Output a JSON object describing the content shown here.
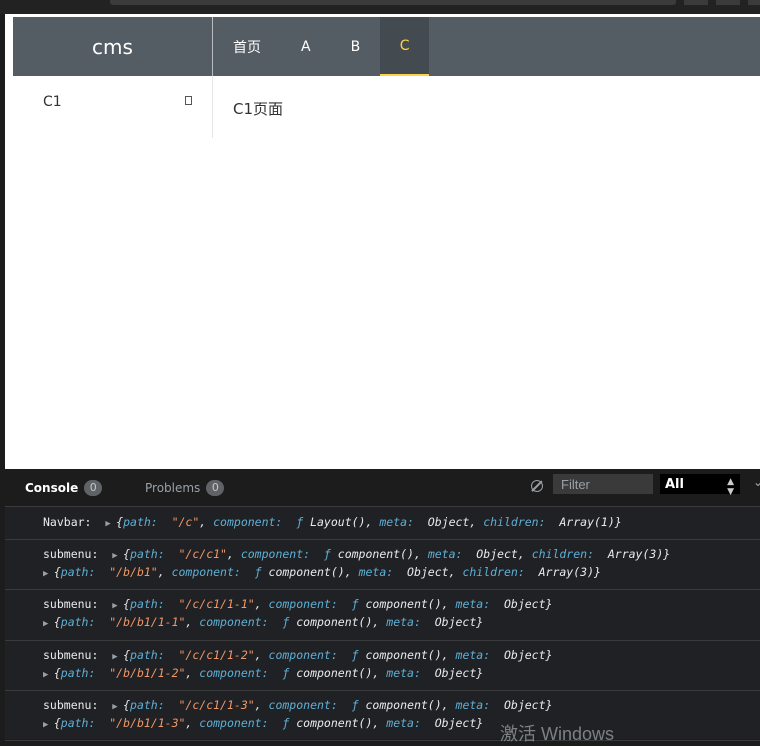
{
  "app": {
    "logo": "cms",
    "nav": [
      "首页",
      "A",
      "B",
      "C"
    ],
    "active_nav": "C",
    "sidebar_item": "C1",
    "main_text": "C1页面"
  },
  "devtools": {
    "tabs": [
      {
        "label": "Console",
        "count": "0"
      },
      {
        "label": "Problems",
        "count": "0"
      }
    ],
    "filter_placeholder": "Filter",
    "level": "All",
    "messages": [
      {
        "label": "Navbar:",
        "objects": [
          [
            [
              "k",
              "path"
            ],
            [
              "s",
              "\"/c\""
            ],
            [
              "k",
              "component"
            ],
            [
              "f",
              "ƒ"
            ],
            [
              "p",
              "Layout()"
            ],
            [
              "k",
              "meta"
            ],
            [
              "p",
              "Object"
            ],
            [
              "k",
              "children"
            ],
            [
              "p",
              "Array(1)"
            ]
          ]
        ]
      },
      {
        "label": "submenu:",
        "objects": [
          [
            [
              "k",
              "path"
            ],
            [
              "s",
              "\"/c/c1\""
            ],
            [
              "k",
              "component"
            ],
            [
              "f",
              "ƒ"
            ],
            [
              "p",
              "component()"
            ],
            [
              "k",
              "meta"
            ],
            [
              "p",
              "Object"
            ],
            [
              "k",
              "children"
            ],
            [
              "p",
              "Array(3)"
            ]
          ],
          [
            [
              "k",
              "path"
            ],
            [
              "s",
              "\"/b/b1\""
            ],
            [
              "k",
              "component"
            ],
            [
              "f",
              "ƒ"
            ],
            [
              "p",
              "component()"
            ],
            [
              "k",
              "meta"
            ],
            [
              "p",
              "Object"
            ],
            [
              "k",
              "children"
            ],
            [
              "p",
              "Array(3)"
            ]
          ]
        ]
      },
      {
        "label": "submenu:",
        "objects": [
          [
            [
              "k",
              "path"
            ],
            [
              "s",
              "\"/c/c1/1-1\""
            ],
            [
              "k",
              "component"
            ],
            [
              "f",
              "ƒ"
            ],
            [
              "p",
              "component()"
            ],
            [
              "k",
              "meta"
            ],
            [
              "p",
              "Object"
            ]
          ],
          [
            [
              "k",
              "path"
            ],
            [
              "s",
              "\"/b/b1/1-1\""
            ],
            [
              "k",
              "component"
            ],
            [
              "f",
              "ƒ"
            ],
            [
              "p",
              "component()"
            ],
            [
              "k",
              "meta"
            ],
            [
              "p",
              "Object"
            ]
          ]
        ]
      },
      {
        "label": "submenu:",
        "objects": [
          [
            [
              "k",
              "path"
            ],
            [
              "s",
              "\"/c/c1/1-2\""
            ],
            [
              "k",
              "component"
            ],
            [
              "f",
              "ƒ"
            ],
            [
              "p",
              "component()"
            ],
            [
              "k",
              "meta"
            ],
            [
              "p",
              "Object"
            ]
          ],
          [
            [
              "k",
              "path"
            ],
            [
              "s",
              "\"/b/b1/1-2\""
            ],
            [
              "k",
              "component"
            ],
            [
              "f",
              "ƒ"
            ],
            [
              "p",
              "component()"
            ],
            [
              "k",
              "meta"
            ],
            [
              "p",
              "Object"
            ]
          ]
        ]
      },
      {
        "label": "submenu:",
        "objects": [
          [
            [
              "k",
              "path"
            ],
            [
              "s",
              "\"/c/c1/1-3\""
            ],
            [
              "k",
              "component"
            ],
            [
              "f",
              "ƒ"
            ],
            [
              "p",
              "component()"
            ],
            [
              "k",
              "meta"
            ],
            [
              "p",
              "Object"
            ]
          ],
          [
            [
              "k",
              "path"
            ],
            [
              "s",
              "\"/b/b1/1-3\""
            ],
            [
              "k",
              "component"
            ],
            [
              "f",
              "ƒ"
            ],
            [
              "p",
              "component()"
            ],
            [
              "k",
              "meta"
            ],
            [
              "p",
              "Object"
            ]
          ]
        ]
      }
    ]
  },
  "watermark": "激活 Windows",
  "colors": {
    "header_bg": "#545c64",
    "active_nav": "#ffd04b",
    "console_key": "#5db0d7",
    "console_string": "#f29766"
  }
}
